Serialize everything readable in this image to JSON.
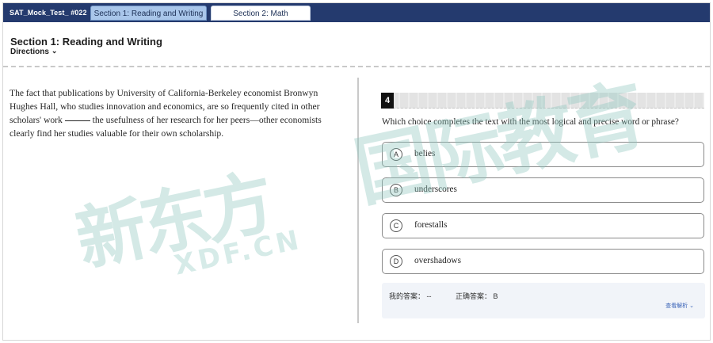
{
  "topbar": {
    "test_name": "SAT_Mock_Test_ #022",
    "tabs": [
      {
        "label": "Section 1: Reading and Writing",
        "active": true
      },
      {
        "label": "Section 2: Math",
        "active": false
      }
    ]
  },
  "header": {
    "section_title": "Section 1: Reading and Writing",
    "directions_label": "Directions"
  },
  "passage": {
    "before_blank": "The fact that publications by University of California-Berkeley economist Bronwyn Hughes Hall, who studies innovation and economics, are so frequently cited in other scholars' work",
    "after_blank": "the usefulness of her research for her peers—other economists clearly find her studies valuable for their own scholarship."
  },
  "question": {
    "number": "4",
    "prompt": "Which choice completes the text with the most logical and precise word or phrase?",
    "choices": [
      {
        "letter": "A",
        "text": "belies"
      },
      {
        "letter": "B",
        "text": "underscores"
      },
      {
        "letter": "C",
        "text": "forestalls"
      },
      {
        "letter": "D",
        "text": "overshadows"
      }
    ]
  },
  "answer": {
    "my_answer_label": "我的答案：",
    "my_answer_value": "--",
    "correct_label": "正确答案：",
    "correct_value": "B",
    "analysis_label": "查看解析"
  },
  "watermark": {
    "text_left": "新东方",
    "text_right": "国际教育",
    "domain": "XDF.CN",
    "color": "#8fc8bf"
  },
  "colors": {
    "topbar": "#243a6e",
    "active_tab": "#a9c6ea",
    "answer_panel": "#f1f4f9"
  },
  "icons": {
    "directions_toggle": "chevron-down-icon",
    "analysis_toggle": "chevron-down-icon"
  }
}
